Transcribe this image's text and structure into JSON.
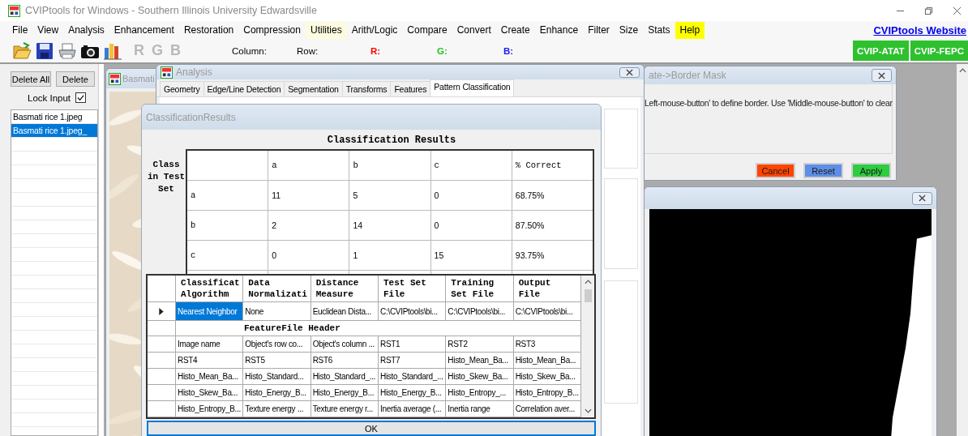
{
  "window": {
    "title": "CVIPtools for Windows - Southern Illinois University Edwardsville"
  },
  "menu": [
    {
      "label": "File",
      "hovered": false,
      "highlighted": false
    },
    {
      "label": "View",
      "hovered": false,
      "highlighted": false
    },
    {
      "label": "Analysis",
      "hovered": false,
      "highlighted": false
    },
    {
      "label": "Enhancement",
      "hovered": false,
      "highlighted": false
    },
    {
      "label": "Restoration",
      "hovered": false,
      "highlighted": false
    },
    {
      "label": "Compression",
      "hovered": false,
      "highlighted": false
    },
    {
      "label": "Utilities",
      "hovered": true,
      "highlighted": false
    },
    {
      "label": "Arith/Logic",
      "hovered": false,
      "highlighted": false
    },
    {
      "label": "Compare",
      "hovered": false,
      "highlighted": false
    },
    {
      "label": "Convert",
      "hovered": false,
      "highlighted": false
    },
    {
      "label": "Create",
      "hovered": false,
      "highlighted": false
    },
    {
      "label": "Enhance",
      "hovered": false,
      "highlighted": false
    },
    {
      "label": "Filter",
      "hovered": false,
      "highlighted": false
    },
    {
      "label": "Size",
      "hovered": false,
      "highlighted": false
    },
    {
      "label": "Stats",
      "hovered": false,
      "highlighted": false
    },
    {
      "label": "Help",
      "hovered": false,
      "highlighted": true
    }
  ],
  "website_link": "CVIPtools Website",
  "toolbar": {
    "channels": [
      {
        "label": "R",
        "disabled": true
      },
      {
        "label": "G",
        "disabled": true
      },
      {
        "label": "B",
        "disabled": true
      }
    ],
    "readouts": [
      {
        "label": "Column:",
        "color": "#000000"
      },
      {
        "label": "Row:",
        "color": "#000000"
      },
      {
        "label": "R:",
        "color": "#ff0000"
      },
      {
        "label": "G:",
        "color": "#22c422"
      },
      {
        "label": "B:",
        "color": "#1a1aff"
      }
    ],
    "apps": [
      "CVIP-ATAT",
      "CVIP-FEPC"
    ]
  },
  "side_panel": {
    "buttons": [
      "Delete All",
      "Delete"
    ],
    "lock_input": {
      "label": "Lock Input",
      "checked": true
    },
    "files": [
      {
        "name": "Basmati rice 1.jpeg",
        "selected": false
      },
      {
        "name": "Basmati rice 1.jpeg_",
        "selected": true
      }
    ]
  },
  "image_window": {
    "title": "Basmati"
  },
  "analysis_window": {
    "title": "Analysis",
    "tabs": [
      {
        "label": "Geometry",
        "selected": false
      },
      {
        "label": "Edge/Line Detection",
        "selected": false
      },
      {
        "label": "Segmentation",
        "selected": false
      },
      {
        "label": "Transforms",
        "selected": false
      },
      {
        "label": "Features",
        "selected": false
      },
      {
        "label": "Pattern Classification",
        "selected": true
      }
    ]
  },
  "border_mask_window": {
    "title": "ate->Border Mask",
    "instructions": "Left-mouse-button' to define border. Use 'Middle-mouse-button' to clear",
    "buttons": [
      {
        "label": "Cancel",
        "color": "#ff4500"
      },
      {
        "label": "Reset",
        "color": "#5f8ee6"
      },
      {
        "label": "Apply",
        "color": "#2ecc40"
      }
    ]
  },
  "classification_window": {
    "title": "ClassificationResults",
    "heading": "Classification Results",
    "row_axis_label": "Class in Test Set",
    "matrix": {
      "columns": [
        "a",
        "b",
        "c",
        "% Correct"
      ],
      "rows": [
        {
          "label": "a",
          "cells": [
            "11",
            "5",
            "0",
            "68.75%"
          ]
        },
        {
          "label": "b",
          "cells": [
            "2",
            "14",
            "0",
            "87.50%"
          ]
        },
        {
          "label": "c",
          "cells": [
            "0",
            "1",
            "15",
            "93.75%"
          ]
        }
      ]
    },
    "grid": {
      "columns": [
        {
          "lines": [
            "Classificat",
            "Algorithm"
          ]
        },
        {
          "lines": [
            "Data",
            "Normalizati"
          ]
        },
        {
          "lines": [
            "Distance",
            "Measure"
          ]
        },
        {
          "lines": [
            "Test Set",
            "File"
          ]
        },
        {
          "lines": [
            "Training",
            "Set File"
          ]
        },
        {
          "lines": [
            "Output",
            "File"
          ]
        }
      ],
      "records": [
        {
          "current": true,
          "cells": [
            {
              "text": "Nearest Neighbor",
              "selected": true
            },
            {
              "text": "None",
              "selected": false
            },
            {
              "text": "Euclidean Dista...",
              "selected": false
            },
            {
              "text": "C:\\CVIPtools\\bi...",
              "selected": false
            },
            {
              "text": "C:\\CVIPtools\\bi...",
              "selected": false
            },
            {
              "text": "C:\\CVIPtools\\bi...",
              "selected": false
            }
          ]
        }
      ],
      "section_title": "FeatureFile Header",
      "feature_rows": [
        [
          "Image name",
          "Object's row co...",
          "Object's column ...",
          "RST1",
          "RST2",
          "RST3"
        ],
        [
          "RST4",
          "RST5",
          "RST6",
          "RST7",
          "Histo_Mean_Ba...",
          "Histo_Mean_Ba..."
        ],
        [
          "Histo_Mean_Ba...",
          "Histo_Standard...",
          "Histo_Standard_...",
          "Histo_Standard_...",
          "Histo_Skew_Ba...",
          "Histo_Skew_Ba..."
        ],
        [
          "Histo_Skew_Ba...",
          "Histo_Energy_B...",
          "Histo_Energy_B...",
          "Histo_Energy_B...",
          "Histo_Entropy_...",
          "Histo_Entropy_B..."
        ],
        [
          "Histo_Entropy_B...",
          "Texture energy ...",
          "Texture energy r...",
          "Inertia average (...",
          "Inertia range",
          "Correlation aver..."
        ]
      ]
    },
    "ok_button": "OK"
  }
}
